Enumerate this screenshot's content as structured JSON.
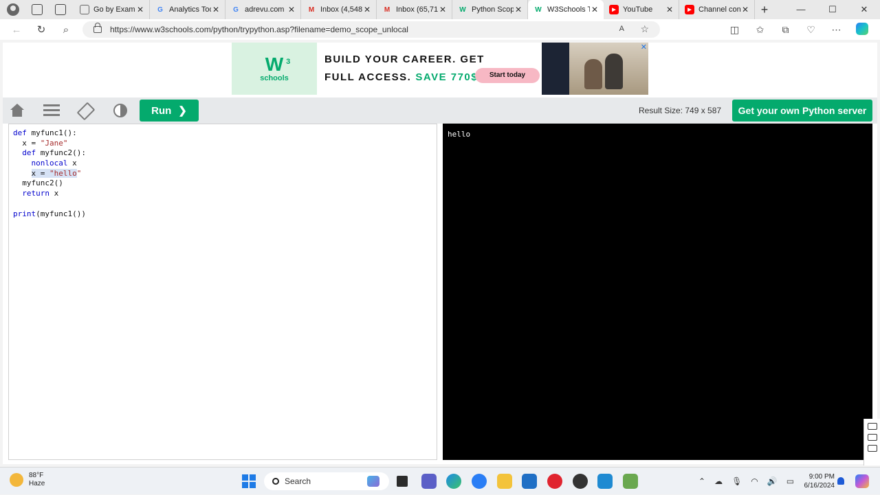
{
  "browser": {
    "tabs": [
      {
        "label": "Go by Exampl",
        "favicon": "page-icon",
        "color": "#666666"
      },
      {
        "label": "Analytics Too",
        "favicon": "google-icon",
        "color": "#4285f4"
      },
      {
        "label": "adrevu.com",
        "favicon": "google-icon",
        "color": "#4285f4"
      },
      {
        "label": "Inbox (4,548",
        "favicon": "gmail-icon",
        "color": "#d93025"
      },
      {
        "label": "Inbox (65,71",
        "favicon": "gmail-icon",
        "color": "#d93025"
      },
      {
        "label": "Python Scop",
        "favicon": "w3schools-icon",
        "color": "#04aa6d"
      },
      {
        "label": "W3Schools T",
        "favicon": "w3schools-icon",
        "color": "#04aa6d",
        "active": true
      },
      {
        "label": "YouTube",
        "favicon": "youtube-icon",
        "color": "#ff0000"
      },
      {
        "label": "Channel con",
        "favicon": "youtube-icon",
        "color": "#ff0000"
      }
    ],
    "tab_close": "✕",
    "new_tab": "+",
    "url": "https://www.w3schools.com/python/trypython.asp?filename=demo_scope_unlocal"
  },
  "ad": {
    "logo_main": "W",
    "logo_sup": "3",
    "logo_sub": "schools",
    "line1": "BUILD YOUR CAREER. GET",
    "line2": "FULL ACCESS.",
    "save": "SAVE 770$",
    "cta": "Start today",
    "close": "✕"
  },
  "toolbar": {
    "run_label": "Run",
    "run_chevron": "❯",
    "result_size": "Result Size: 749 x 587",
    "server_button": "Get your own Python server"
  },
  "editor": {
    "lines": [
      "def myfunc1():",
      "  x = \"Jane\"",
      "  def myfunc2():",
      "    nonlocal x",
      "    x = \"hello\"",
      "  myfunc2()",
      "  return x",
      "",
      "print(myfunc1())"
    ]
  },
  "result": {
    "output": "hello"
  },
  "taskbar": {
    "temperature": "88°F",
    "weather": "Haze",
    "search_label": "Search",
    "time": "9:00 PM",
    "date": "6/16/2024",
    "colors": {
      "start": "#1e7be6",
      "accent": "#04aa6d"
    }
  }
}
